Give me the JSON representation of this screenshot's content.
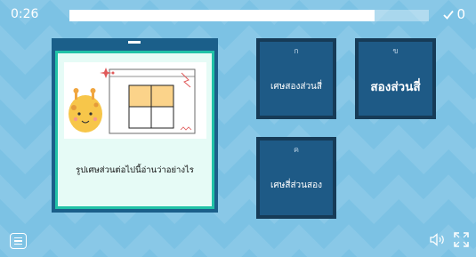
{
  "status": {
    "timer": "0:26",
    "progress": 0.85,
    "score_icon": "check-icon",
    "score": "0"
  },
  "question": {
    "image_icon": "giraffe-fraction-grid-illustration",
    "text": "รูปเศษส่วนต่อไปนี้อ่านว่าอย่างไร"
  },
  "answers": [
    {
      "letter": "ก",
      "text": "เศษสองส่วนสี่"
    },
    {
      "letter": "ข",
      "text": "สองส่วนสี่"
    },
    {
      "letter": "ค",
      "text": "เศษสี่ส่วนสอง"
    }
  ],
  "controls": {
    "menu_icon": "menu-icon",
    "sound_icon": "speaker-icon",
    "fullscreen_icon": "fullscreen-icon"
  },
  "colors": {
    "background": "#7cc2e4",
    "card_frame": "#1b5f8a",
    "card_border": "#22c2a7",
    "answer_fill": "#1e5a86",
    "shaded_cell": "#fbd38a"
  }
}
